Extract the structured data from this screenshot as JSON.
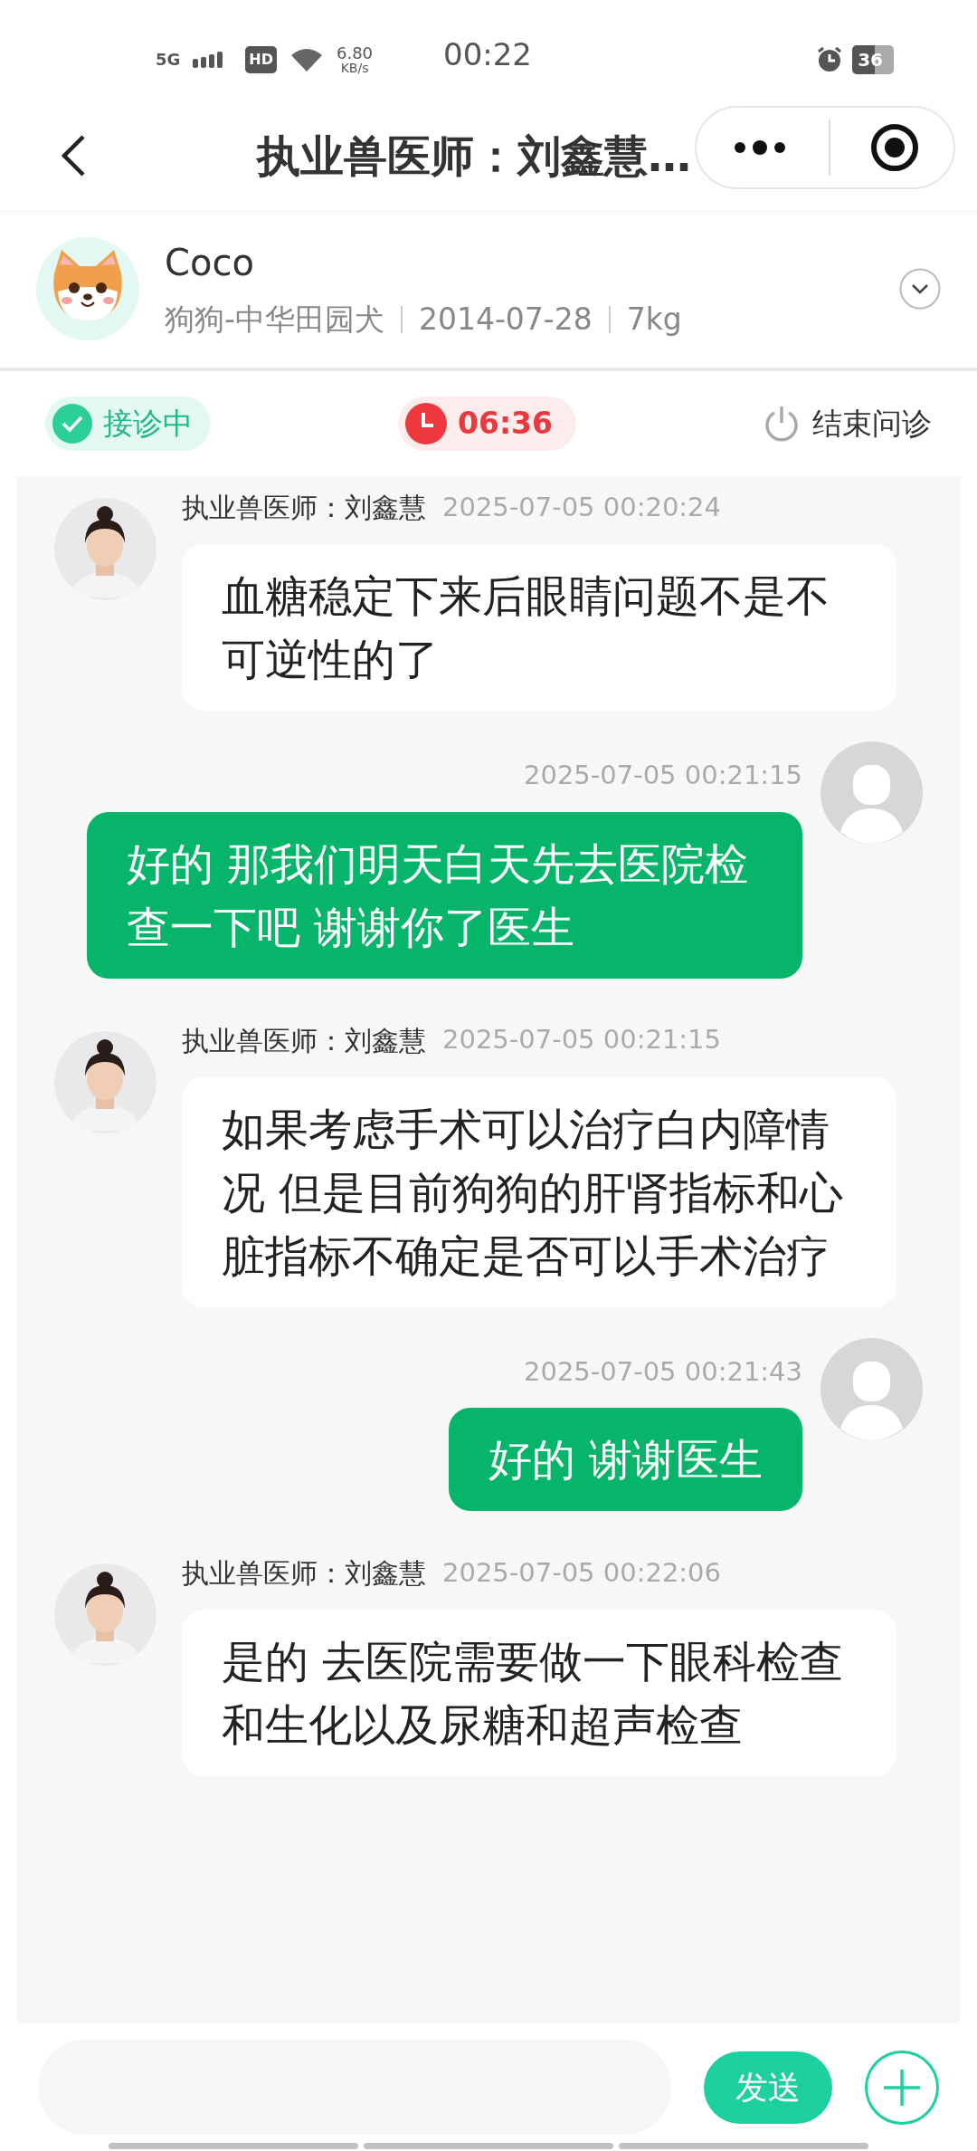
{
  "status_bar": {
    "network": "5G",
    "hd": "HD",
    "speed": "6.80",
    "speed_unit": "KB/s",
    "time": "00:22",
    "battery": "36"
  },
  "header": {
    "title": "执业兽医师：刘鑫慧…"
  },
  "pet": {
    "name": "Coco",
    "breed": "狗狗-中华田园犬",
    "birthday": "2014-07-28",
    "weight": "7kg"
  },
  "consult": {
    "status_label": "接诊中",
    "timer": "06:36",
    "end_label": "结束问诊"
  },
  "messages": [
    {
      "kind": "doctor",
      "name": "执业兽医师：刘鑫慧",
      "time": "2025-07-05 00:20:24",
      "text": "血糖稳定下来后眼睛问题不是不可逆性的了"
    },
    {
      "kind": "user",
      "time": "2025-07-05 00:21:15",
      "text": "好的 那我们明天白天先去医院检查一下吧 谢谢你了医生"
    },
    {
      "kind": "doctor",
      "name": "执业兽医师：刘鑫慧",
      "time": "2025-07-05 00:21:15",
      "text": "如果考虑手术可以治疗白内障情况 但是目前狗狗的肝肾指标和心脏指标不确定是否可以手术治疗"
    },
    {
      "kind": "user",
      "time": "2025-07-05 00:21:43",
      "text": "好的 谢谢医生"
    },
    {
      "kind": "doctor",
      "name": "执业兽医师：刘鑫慧",
      "time": "2025-07-05 00:22:06",
      "text": "是的 去医院需要做一下眼科检查和生化以及尿糖和超声检查"
    }
  ],
  "composer": {
    "send_label": "发送"
  }
}
